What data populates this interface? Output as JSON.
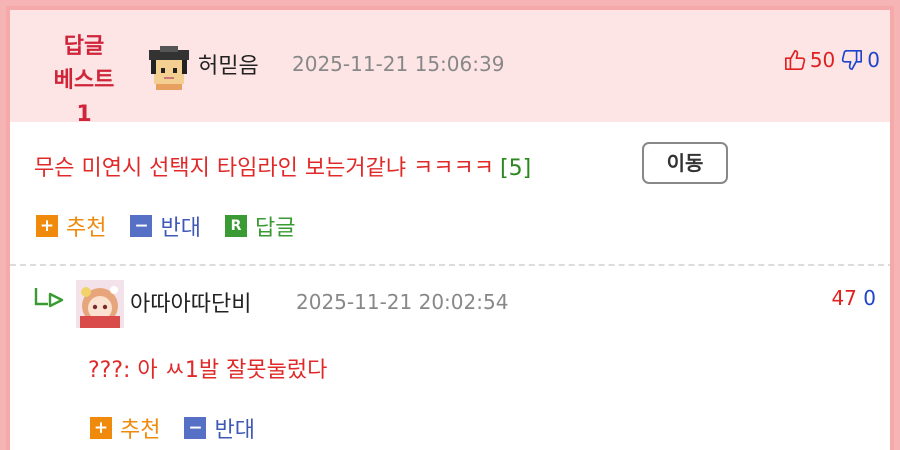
{
  "best_comment": {
    "badge_line1": "답글",
    "badge_line2": "베스트1",
    "nickname": "허믿음",
    "datetime": "2025-11-21 15:06:39",
    "up_count": "50",
    "down_count": "0",
    "text": "무슨 미연시 선택지 타임라인 보는거같냐 ㅋㅋㅋㅋ",
    "reply_count": "[5]",
    "move_label": "이동",
    "actions": {
      "recommend_icon": "+",
      "recommend_label": "추천",
      "oppose_icon": "−",
      "oppose_label": "반대",
      "reply_icon": "R",
      "reply_label": "답글"
    }
  },
  "reply": {
    "nickname": "아따아따단비",
    "datetime": "2025-11-21 20:02:54",
    "up_count": "47",
    "down_count": "0",
    "text": "???: 아 ㅆ1발 잘못눌렀다",
    "actions": {
      "recommend_icon": "+",
      "recommend_label": "추천",
      "oppose_icon": "−",
      "oppose_label": "반대"
    }
  },
  "colors": {
    "accent_red": "#e02a2a",
    "badge_red": "#d0243a",
    "down_blue": "#1e44cc",
    "header_pink": "#fde5e5",
    "border_pink": "#f6a9a9",
    "recommend_orange": "#ef8a0c",
    "oppose_blue": "#5570c4",
    "reply_green": "#3a9a33"
  },
  "icons": {
    "thumb_up": "thumbs-up-icon",
    "thumb_down": "thumbs-down-icon",
    "reply_arrow": "reply-arrow-icon"
  }
}
